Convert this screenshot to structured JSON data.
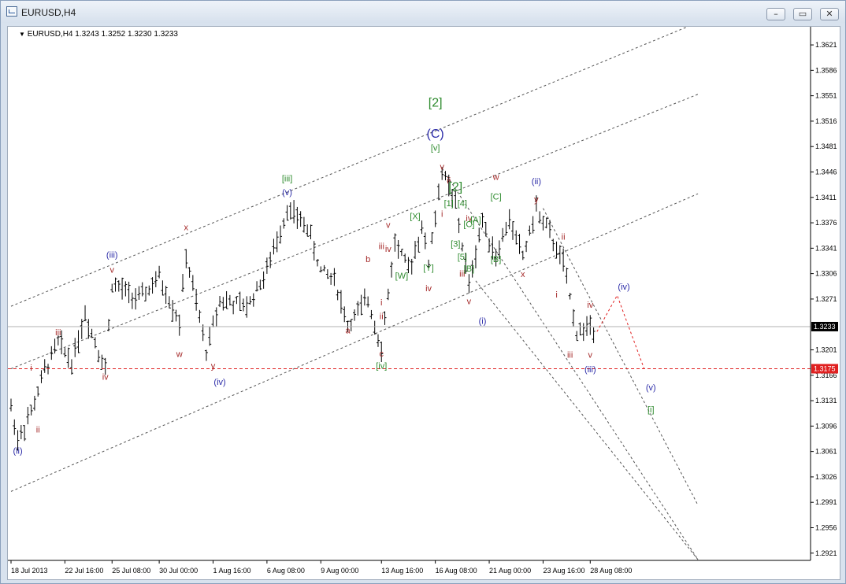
{
  "window": {
    "title": "EURUSD,H4"
  },
  "chart_header": {
    "symbol_line": "EURUSD,H4  1.3243 1.3252 1.3230 1.3233"
  },
  "chart_data": {
    "type": "ohlc",
    "symbol": "EURUSD",
    "timeframe": "H4",
    "ohlc": {
      "open": 1.3243,
      "high": 1.3252,
      "low": 1.323,
      "close": 1.3233
    },
    "price_axis": [
      1.3621,
      1.3586,
      1.3551,
      1.3516,
      1.3481,
      1.3446,
      1.3411,
      1.3376,
      1.3341,
      1.3306,
      1.3271,
      1.3201,
      1.3166,
      1.3131,
      1.3096,
      1.3061,
      1.3026,
      1.2991,
      1.2956,
      1.2921
    ],
    "ylim": [
      1.2911,
      1.3646
    ],
    "time_axis": [
      "18 Jul 2013",
      "22 Jul 16:00",
      "25 Jul 08:00",
      "30 Jul 00:00",
      "1 Aug 16:00",
      "6 Aug 08:00",
      "9 Aug 00:00",
      "13 Aug 16:00",
      "16 Aug 08:00",
      "21 Aug 00:00",
      "23 Aug 16:00",
      "28 Aug 08:00"
    ],
    "current_price": {
      "value": 1.3233,
      "label": "1.3233"
    },
    "level_line": {
      "value": 1.3175,
      "label": "1.3175",
      "color": "#e02020"
    },
    "colors": {
      "red": "#a52a2a",
      "green": "#2e8b2e",
      "blue": "#2b2ba8",
      "bars": "#000000",
      "dashed": "#555555"
    },
    "wave_labels": [
      {
        "text": "(ii)",
        "color": "blue",
        "t": 1,
        "p": 1.3058
      },
      {
        "text": "ii",
        "color": "red",
        "t": 4,
        "p": 1.3087
      },
      {
        "text": "i",
        "color": "red",
        "t": 3,
        "p": 1.3172
      },
      {
        "text": "iii",
        "color": "red",
        "t": 7,
        "p": 1.3221
      },
      {
        "text": "iv",
        "color": "red",
        "t": 14,
        "p": 1.316
      },
      {
        "text": "v",
        "color": "red",
        "t": 15,
        "p": 1.3307
      },
      {
        "text": "(iii)",
        "color": "blue",
        "t": 15,
        "p": 1.3328
      },
      {
        "text": "w",
        "color": "red",
        "t": 25,
        "p": 1.3191
      },
      {
        "text": "x",
        "color": "red",
        "t": 26,
        "p": 1.3366
      },
      {
        "text": "y",
        "color": "red",
        "t": 30,
        "p": 1.3175
      },
      {
        "text": "(iv)",
        "color": "blue",
        "t": 31,
        "p": 1.3153
      },
      {
        "text": "(v)",
        "color": "blue",
        "t": 41,
        "p": 1.3414
      },
      {
        "text": "[iii]",
        "color": "green",
        "t": 41,
        "p": 1.3433
      },
      {
        "text": "a",
        "color": "red",
        "t": 50,
        "p": 1.3224
      },
      {
        "text": "b",
        "color": "red",
        "t": 53,
        "p": 1.3322
      },
      {
        "text": "c",
        "color": "red",
        "t": 55,
        "p": 1.3192
      },
      {
        "text": "[iv]",
        "color": "green",
        "t": 55,
        "p": 1.3175
      },
      {
        "text": "i",
        "color": "red",
        "t": 55,
        "p": 1.3262
      },
      {
        "text": "ii",
        "color": "red",
        "t": 55,
        "p": 1.3243
      },
      {
        "text": "iii",
        "color": "red",
        "t": 55,
        "p": 1.334
      },
      {
        "text": "iv",
        "color": "red",
        "t": 56,
        "p": 1.3336
      },
      {
        "text": "v",
        "color": "red",
        "t": 56,
        "p": 1.3369
      },
      {
        "text": "[W]",
        "color": "green",
        "t": 58,
        "p": 1.3299
      },
      {
        "text": "[X]",
        "color": "green",
        "t": 60,
        "p": 1.3381
      },
      {
        "text": "[Y]",
        "color": "green",
        "t": 62,
        "p": 1.331
      },
      {
        "text": "iv",
        "color": "red",
        "t": 62,
        "p": 1.3282
      },
      {
        "text": "[2]",
        "color": "green",
        "t": 63,
        "p": 1.3536
      },
      {
        "text": "(C)",
        "color": "blue",
        "t": 63,
        "p": 1.3493
      },
      {
        "text": "[v]",
        "color": "green",
        "t": 63,
        "p": 1.3475
      },
      {
        "text": "v",
        "color": "red",
        "t": 64,
        "p": 1.3449
      },
      {
        "text": "ii",
        "color": "red",
        "t": 65,
        "p": 1.343
      },
      {
        "text": "i",
        "color": "red",
        "t": 64,
        "p": 1.3384
      },
      {
        "text": "[1]",
        "color": "green",
        "t": 65,
        "p": 1.3399
      },
      {
        "text": "[2]",
        "color": "green",
        "t": 66,
        "p": 1.342
      },
      {
        "text": "[4]",
        "color": "green",
        "t": 67,
        "p": 1.3399
      },
      {
        "text": "iv",
        "color": "red",
        "t": 68,
        "p": 1.3378
      },
      {
        "text": "[3]",
        "color": "green",
        "t": 66,
        "p": 1.3343
      },
      {
        "text": "[5]",
        "color": "green",
        "t": 67,
        "p": 1.3325
      },
      {
        "text": "[C]",
        "color": "green",
        "t": 68,
        "p": 1.337
      },
      {
        "text": "[A]",
        "color": "green",
        "t": 69,
        "p": 1.3376
      },
      {
        "text": "iii",
        "color": "red",
        "t": 67,
        "p": 1.3302
      },
      {
        "text": "[B]",
        "color": "green",
        "t": 68,
        "p": 1.3309
      },
      {
        "text": "v",
        "color": "red",
        "t": 68,
        "p": 1.3264
      },
      {
        "text": "(i)",
        "color": "blue",
        "t": 70,
        "p": 1.3237
      },
      {
        "text": "w",
        "color": "red",
        "t": 72,
        "p": 1.3435
      },
      {
        "text": "[C]",
        "color": "green",
        "t": 72,
        "p": 1.3408
      },
      {
        "text": "[B]",
        "color": "green",
        "t": 72,
        "p": 1.3322
      },
      {
        "text": "(ii)",
        "color": "blue",
        "t": 78,
        "p": 1.3429
      },
      {
        "text": "y",
        "color": "red",
        "t": 78,
        "p": 1.3404
      },
      {
        "text": "x",
        "color": "red",
        "t": 76,
        "p": 1.3301
      },
      {
        "text": "ii",
        "color": "red",
        "t": 82,
        "p": 1.3353
      },
      {
        "text": "i",
        "color": "red",
        "t": 81,
        "p": 1.3273
      },
      {
        "text": "iv",
        "color": "red",
        "t": 86,
        "p": 1.3259
      },
      {
        "text": "iii",
        "color": "red",
        "t": 83,
        "p": 1.319
      },
      {
        "text": "v",
        "color": "red",
        "t": 86,
        "p": 1.319
      },
      {
        "text": "(iii)",
        "color": "blue",
        "t": 86,
        "p": 1.317
      },
      {
        "text": "(iv)",
        "color": "blue",
        "t": 91,
        "p": 1.3284
      },
      {
        "text": "(v)",
        "color": "blue",
        "t": 95,
        "p": 1.3145
      },
      {
        "text": "[i]",
        "color": "green",
        "t": 95,
        "p": 1.3115
      }
    ],
    "projection": [
      {
        "t": 87,
        "p": 1.3226
      },
      {
        "t": 90,
        "p": 1.3276
      },
      {
        "t": 94,
        "p": 1.3175
      }
    ],
    "channels": [
      [
        {
          "t": 0,
          "p": 1.3261
        },
        {
          "t": 102,
          "p": 1.3652
        }
      ],
      [
        {
          "t": 0,
          "p": 1.3175
        },
        {
          "t": 102,
          "p": 1.3553
        }
      ],
      [
        {
          "t": 0,
          "p": 1.3006
        },
        {
          "t": 102,
          "p": 1.3416
        }
      ],
      [
        {
          "t": 79,
          "p": 1.3396
        },
        {
          "t": 102,
          "p": 1.2987
        }
      ],
      [
        {
          "t": 64,
          "p": 1.3451
        },
        {
          "t": 102,
          "p": 1.2912
        }
      ],
      [
        {
          "t": 69,
          "p": 1.3296
        },
        {
          "t": 102,
          "p": 1.2912
        }
      ]
    ]
  }
}
